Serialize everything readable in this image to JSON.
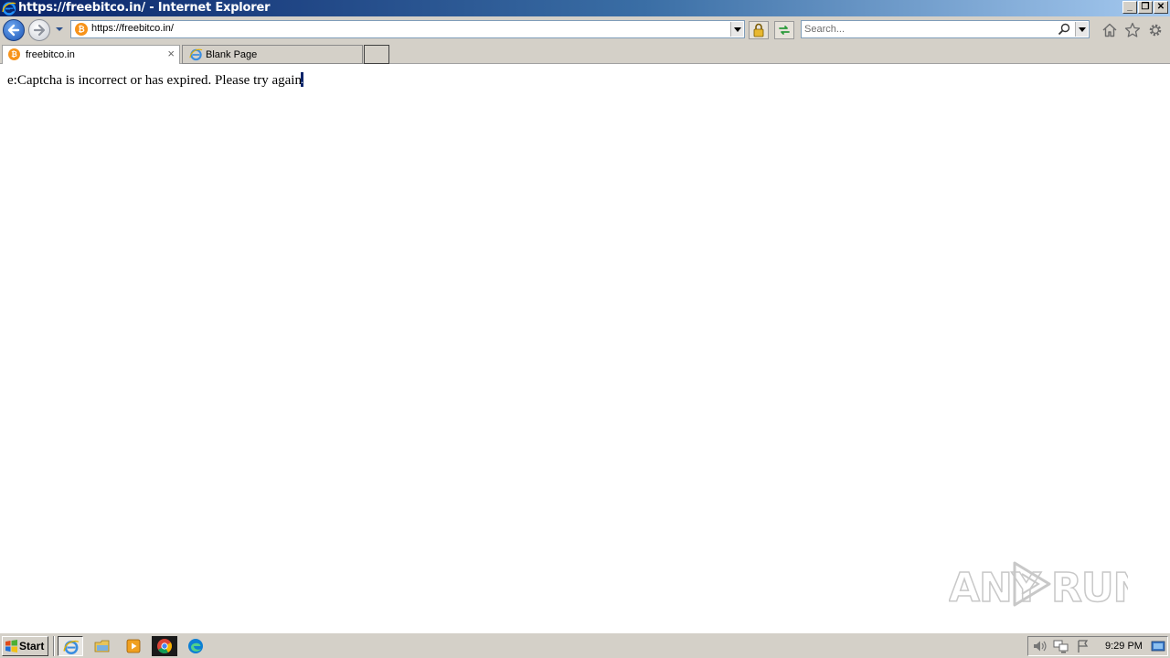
{
  "window": {
    "title": "https://freebitco.in/ - Internet Explorer",
    "controls": {
      "minimize": "_",
      "restore": "❐",
      "close": "✕"
    }
  },
  "navbar": {
    "address": "https://freebitco.in/",
    "search_placeholder": "Search..."
  },
  "tabs": [
    {
      "label": "freebitco.in",
      "active": true,
      "close": "×"
    },
    {
      "label": "Blank Page",
      "active": false
    }
  ],
  "page": {
    "message": "e:Captcha is incorrect or has expired. Please try again",
    "message_end": "."
  },
  "watermark": {
    "text": "ANY RUN"
  },
  "taskbar": {
    "start_label": "Start",
    "apps": [
      "internet-explorer",
      "file-explorer",
      "media-player",
      "chrome",
      "edge"
    ],
    "clock": "9:29 PM"
  },
  "colors": {
    "titlebar_start": "#0a246a",
    "titlebar_end": "#a6caf0",
    "chrome_gray": "#d4d0c8",
    "bitcoin_orange": "#f7931a"
  }
}
